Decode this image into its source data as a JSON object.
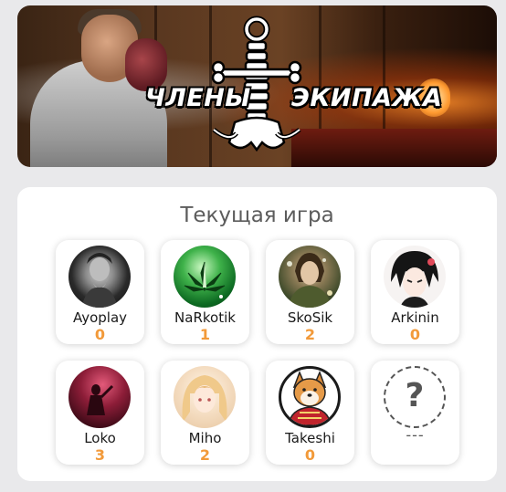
{
  "banner": {
    "title_left": "ЧЛЕНЫ",
    "title_right": "ЭКИПАЖА"
  },
  "current_game": {
    "title": "Текущая игра",
    "players": [
      {
        "name": "Ayoplay",
        "score": "0",
        "avatar": "bearded-old-man-avatar"
      },
      {
        "name": "NaRkotik",
        "score": "1",
        "avatar": "green-leaf-avatar"
      },
      {
        "name": "SkoSik",
        "score": "2",
        "avatar": "forest-warrior-avatar"
      },
      {
        "name": "Arkinin",
        "score": "0",
        "avatar": "anime-boy-avatar"
      },
      {
        "name": "Loko",
        "score": "3",
        "avatar": "red-stage-figure-avatar"
      },
      {
        "name": "Miho",
        "score": "2",
        "avatar": "blonde-anime-girl-avatar"
      },
      {
        "name": "Takeshi",
        "score": "0",
        "avatar": "shiba-samurai-avatar"
      },
      {
        "name": "---",
        "score": "",
        "avatar": "question-mark-placeholder",
        "placeholder_symbol": "?"
      }
    ]
  },
  "colors": {
    "background": "#e9e9eb",
    "score": "#f29a3a",
    "title": "#5c5c5c"
  }
}
